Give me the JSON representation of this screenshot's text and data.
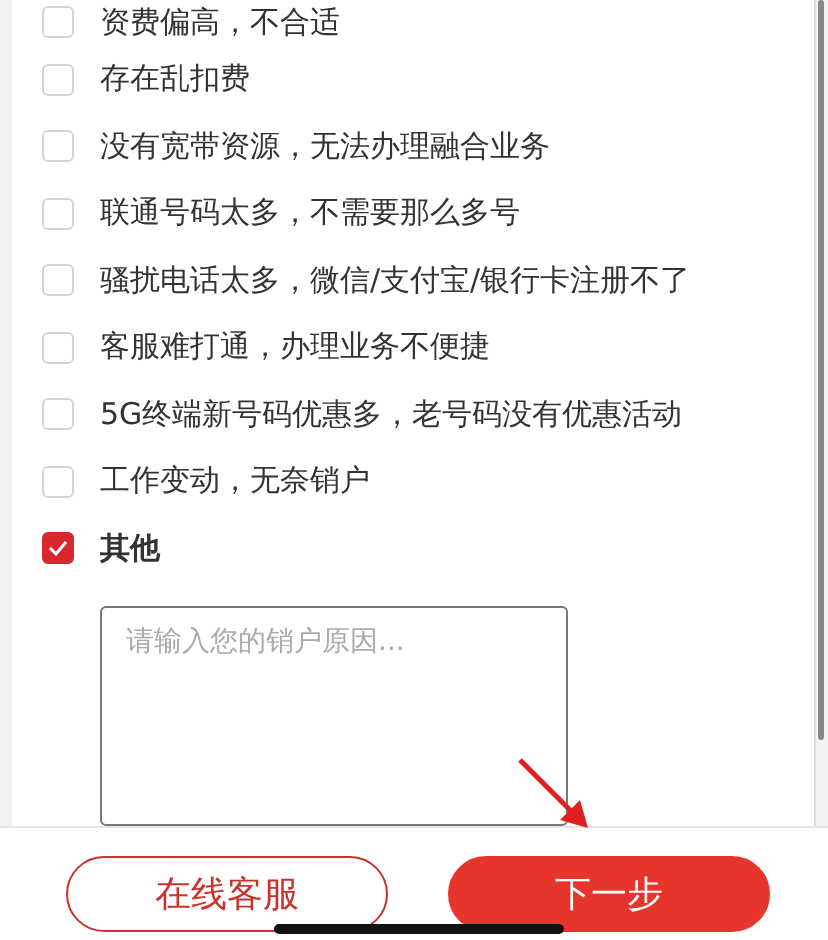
{
  "reasons": [
    {
      "label": "资费偏高，不合适",
      "checked": false
    },
    {
      "label": "存在乱扣费",
      "checked": false
    },
    {
      "label": "没有宽带资源，无法办理融合业务",
      "checked": false
    },
    {
      "label": "联通号码太多，不需要那么多号",
      "checked": false
    },
    {
      "label": "骚扰电话太多，微信/支付宝/银行卡注册不了",
      "checked": false
    },
    {
      "label": "客服难打通，办理业务不便捷",
      "checked": false
    },
    {
      "label": "5G终端新号码优惠多，老号码没有优惠活动",
      "checked": false
    },
    {
      "label": "工作变动，无奈销户",
      "checked": false
    },
    {
      "label": "其他",
      "checked": true
    }
  ],
  "reason_input": {
    "placeholder": "请输入您的销户原因..."
  },
  "buttons": [
    {
      "label": "在线客服",
      "kind": "outline"
    },
    {
      "label": "下一步",
      "kind": "primary"
    }
  ]
}
